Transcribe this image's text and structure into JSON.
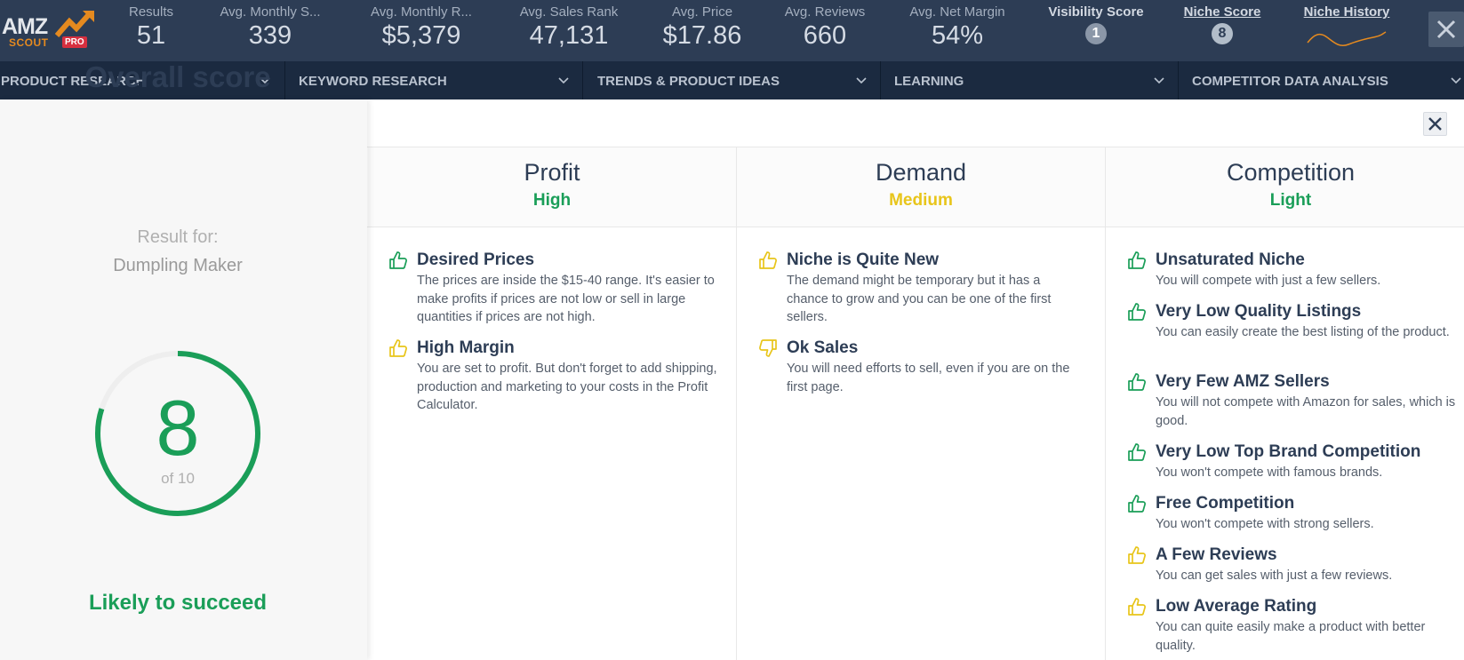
{
  "app": {
    "logo_text": "AMZ",
    "logo_sub": "SCOUT",
    "logo_badge": "PRO"
  },
  "stats": [
    {
      "label": "Results",
      "value": "51"
    },
    {
      "label": "Avg. Monthly S...",
      "value": "339"
    },
    {
      "label": "Avg. Monthly R...",
      "value": "$5,379"
    },
    {
      "label": "Avg. Sales Rank",
      "value": "47,131"
    },
    {
      "label": "Avg. Price",
      "value": "$17.86"
    },
    {
      "label": "Avg. Reviews",
      "value": "660"
    },
    {
      "label": "Avg. Net Margin",
      "value": "54%"
    }
  ],
  "visibility": {
    "label": "Visibility Score",
    "value": "1"
  },
  "niche_score": {
    "label": "Niche Score",
    "value": "8"
  },
  "niche_history": {
    "label": "Niche History"
  },
  "nav": [
    {
      "label": "PRODUCT RESEARCH"
    },
    {
      "label": "KEYWORD RESEARCH"
    },
    {
      "label": "TRENDS & PRODUCT IDEAS"
    },
    {
      "label": "LEARNING"
    },
    {
      "label": "COMPETITOR DATA ANALYSIS"
    }
  ],
  "overall": {
    "title": "Overall score",
    "result_for_label": "Result for:",
    "product": "Dumpling Maker",
    "score": 8,
    "score_text": "8",
    "max_text": "of 10",
    "verdict": "Likely to succeed"
  },
  "columns": [
    {
      "title": "Profit",
      "level": "High",
      "level_color": "#1a9e58",
      "items": [
        {
          "sentiment": "positive",
          "title": "Desired Prices",
          "desc": "The prices are inside the $15-40 range. It's easier to make profits if prices are not low or sell in large quantities if prices are not high."
        },
        {
          "sentiment": "neutral",
          "title": "High Margin",
          "desc": "You are set to profit. But don't forget to add shipping, production and marketing to your costs in the Profit Calculator."
        }
      ]
    },
    {
      "title": "Demand",
      "level": "Medium",
      "level_color": "#e8c51a",
      "items": [
        {
          "sentiment": "neutral",
          "title": "Niche is Quite New",
          "desc": "The demand might be temporary but it has a chance to grow and you can be one of the first sellers."
        },
        {
          "sentiment": "negative",
          "title": "Ok Sales",
          "desc": "You will need efforts to sell, even if you are on the first page."
        }
      ]
    },
    {
      "title": "Competition",
      "level": "Light",
      "level_color": "#1a9e58",
      "items": [
        {
          "sentiment": "positive",
          "title": "Unsaturated Niche",
          "desc": "You will compete with just a few sellers."
        },
        {
          "sentiment": "positive",
          "title": "Very Low Quality Listings",
          "desc": "You can easily create the best listing of the product."
        },
        {
          "sentiment": "positive",
          "title": "Very Few AMZ Sellers",
          "desc": "You will not compete with Amazon for sales, which is good."
        },
        {
          "sentiment": "positive",
          "title": "Very Low Top Brand Competition",
          "desc": "You won't compete with famous brands."
        },
        {
          "sentiment": "positive",
          "title": "Free Competition",
          "desc": "You won't compete with strong sellers."
        },
        {
          "sentiment": "neutral",
          "title": "A Few Reviews",
          "desc": "You can get sales with just a few reviews."
        },
        {
          "sentiment": "neutral",
          "title": "Low Average Rating",
          "desc": "You can quite easily make a product with better quality."
        }
      ]
    }
  ],
  "colors": {
    "topbar": "#2d3d55",
    "navbar": "#1b2a40",
    "green": "#1a9e58",
    "yellow": "#e8c51a"
  }
}
